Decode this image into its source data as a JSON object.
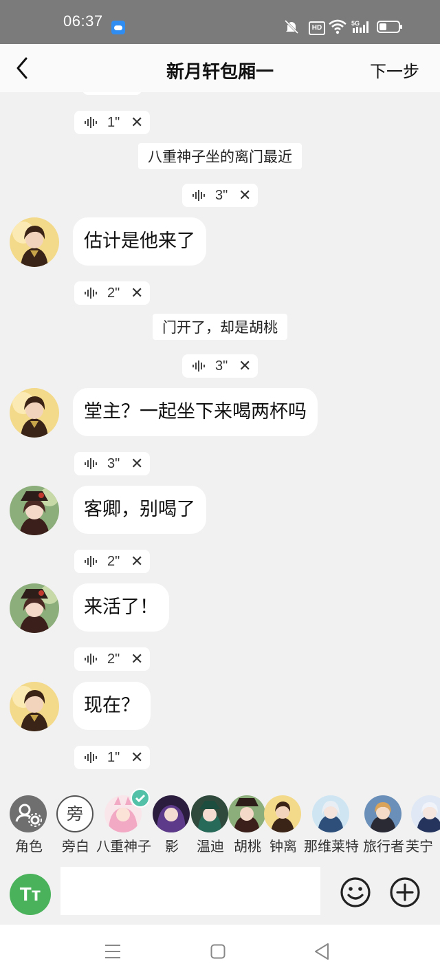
{
  "status_bar": {
    "time": "06:37",
    "hd_label": "HD",
    "network_label": "5G"
  },
  "header": {
    "title": "新月轩包厢一",
    "next_label": "下一步"
  },
  "chat": {
    "items": [
      {
        "type": "voice",
        "duration": "1\""
      },
      {
        "type": "narration",
        "text": "八重神子坐的离门最近"
      },
      {
        "type": "voice",
        "duration": "3\""
      },
      {
        "type": "message",
        "speaker": "钟离",
        "text": "估计是他来了"
      },
      {
        "type": "voice",
        "duration": "2\""
      },
      {
        "type": "narration",
        "text": "门开了，却是胡桃"
      },
      {
        "type": "voice",
        "duration": "3\""
      },
      {
        "type": "message",
        "speaker": "钟离",
        "text": "堂主？一起坐下来喝两杯吗"
      },
      {
        "type": "voice",
        "duration": "3\""
      },
      {
        "type": "message",
        "speaker": "胡桃",
        "text": "客卿，别喝了"
      },
      {
        "type": "voice",
        "duration": "2\""
      },
      {
        "type": "message",
        "speaker": "胡桃",
        "text": "来活了！"
      },
      {
        "type": "voice",
        "duration": "2\""
      },
      {
        "type": "message",
        "speaker": "钟离",
        "text": "现在？"
      },
      {
        "type": "voice",
        "duration": "1\""
      }
    ]
  },
  "characters": [
    {
      "name": "角色",
      "icon": "role-settings-icon"
    },
    {
      "name": "旁白",
      "icon_text": "旁"
    },
    {
      "name": "八重神子",
      "selected": true
    },
    {
      "name": "影"
    },
    {
      "name": "温迪"
    },
    {
      "name": "胡桃"
    },
    {
      "name": "钟离"
    },
    {
      "name": "那维莱特"
    },
    {
      "name": "旅行者"
    },
    {
      "name": "芙宁"
    }
  ],
  "input": {
    "text_style_label": "Tт",
    "placeholder": ""
  },
  "colors": {
    "background": "#f1f1f1",
    "status_bar": "#7b7b7b",
    "accent_green": "#4ab25b",
    "check_teal": "#53c1a8"
  }
}
